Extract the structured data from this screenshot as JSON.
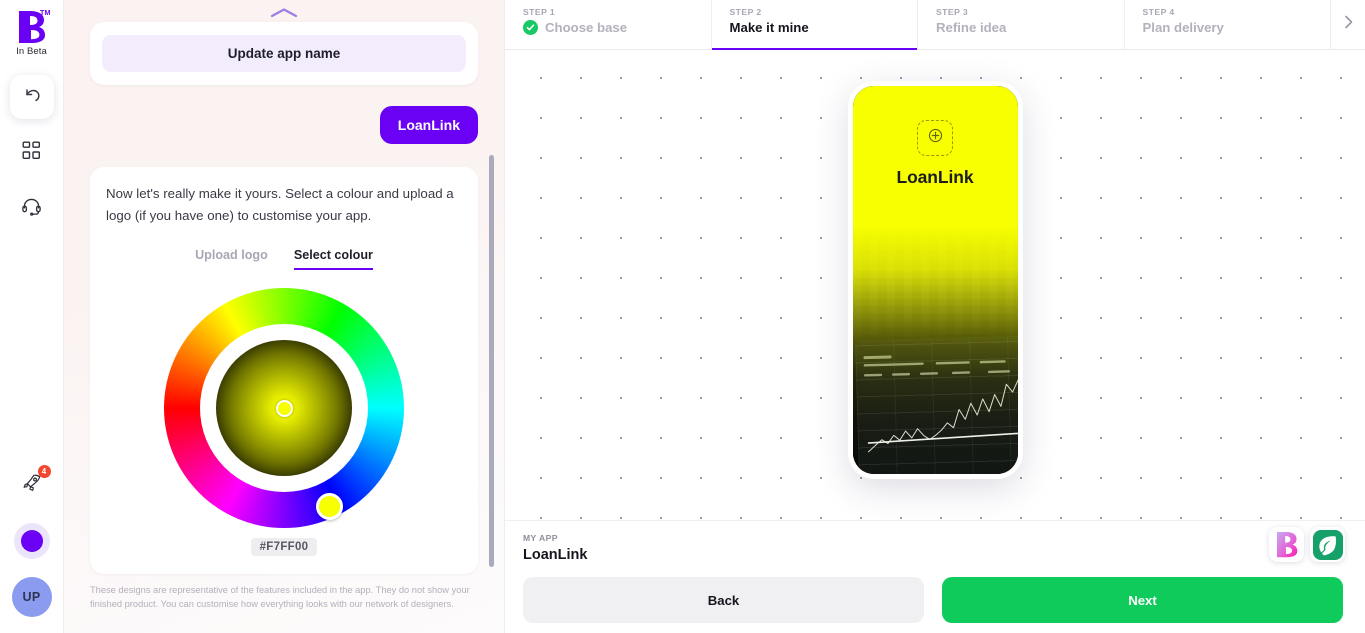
{
  "rail": {
    "brand_label": "In Beta",
    "brand_tm": "TM",
    "undo_icon": "undo-arrow-icon",
    "apps_icon": "grid-apps-icon",
    "support_icon": "headset-support-icon",
    "rocket_icon": "rocket-icon",
    "rocket_badge": "4",
    "color_chip_value": "#6A00F4",
    "avatar_initials": "UP"
  },
  "chat_panel": {
    "collapse_icon": "chevron-up-icon",
    "update_name_button": "Update app name",
    "user_message": "LoanLink",
    "assistant_message": "Now let's really make it yours. Select a colour and upload a logo (if you have one) to customise your app.",
    "tabs": [
      {
        "label": "Upload logo",
        "active": false
      },
      {
        "label": "Select colour",
        "active": true
      }
    ],
    "colour_picker": {
      "hex": "#F7FF00",
      "ring_handle_color": "#F7FF00",
      "inner_handle_color": "#F7FF00"
    },
    "disclaimer": "These designs are representative of the features included in the app. They do not show your finished product. You can customise how everything looks with our network of designers."
  },
  "steps": {
    "items": [
      {
        "num": "STEP 1",
        "title": "Choose base",
        "state": "done"
      },
      {
        "num": "STEP 2",
        "title": "Make it mine",
        "state": "active"
      },
      {
        "num": "STEP 3",
        "title": "Refine idea",
        "state": "pending"
      },
      {
        "num": "STEP 4",
        "title": "Plan delivery",
        "state": "pending"
      }
    ],
    "next_icon": "chevron-right-icon"
  },
  "preview": {
    "logo_placeholder_icon": "plus-circle-icon",
    "app_name": "LoanLink",
    "accent_color": "#F7FF00"
  },
  "bottom_bar": {
    "my_app_label": "MY APP",
    "app_name": "LoanLink",
    "back_label": "Back",
    "next_label": "Next",
    "brand_logos": [
      {
        "name": "builder-b-logo"
      },
      {
        "name": "leaf-logo"
      }
    ]
  }
}
